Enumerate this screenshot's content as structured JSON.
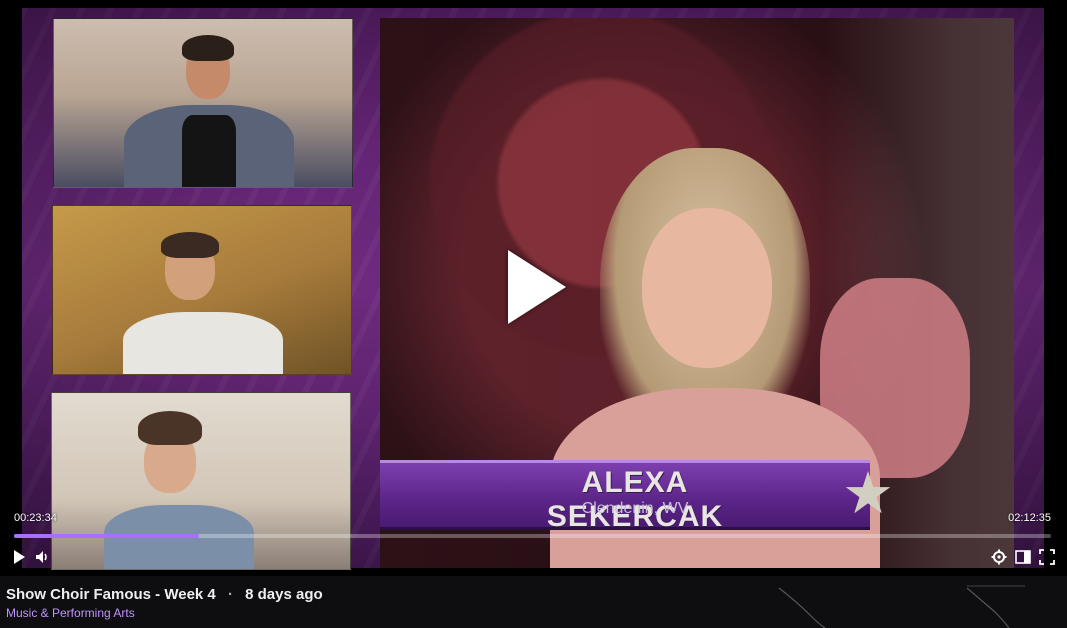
{
  "video": {
    "lower_third_name": "ALEXA SEKERCAK",
    "lower_third_location": "Clendenin, WV"
  },
  "player": {
    "current_time": "00:23:34",
    "duration": "02:12:35",
    "progress_fraction": 0.178,
    "accent_color": "#a970ff"
  },
  "controls": {
    "left": [
      "play-icon",
      "volume-icon"
    ],
    "right": [
      "gear-icon",
      "theatre-mode-icon",
      "fullscreen-icon"
    ]
  },
  "info": {
    "title": "Show Choir Famous - Week 4",
    "separator": "·",
    "age": "8 days ago",
    "category": "Music & Performing Arts"
  }
}
